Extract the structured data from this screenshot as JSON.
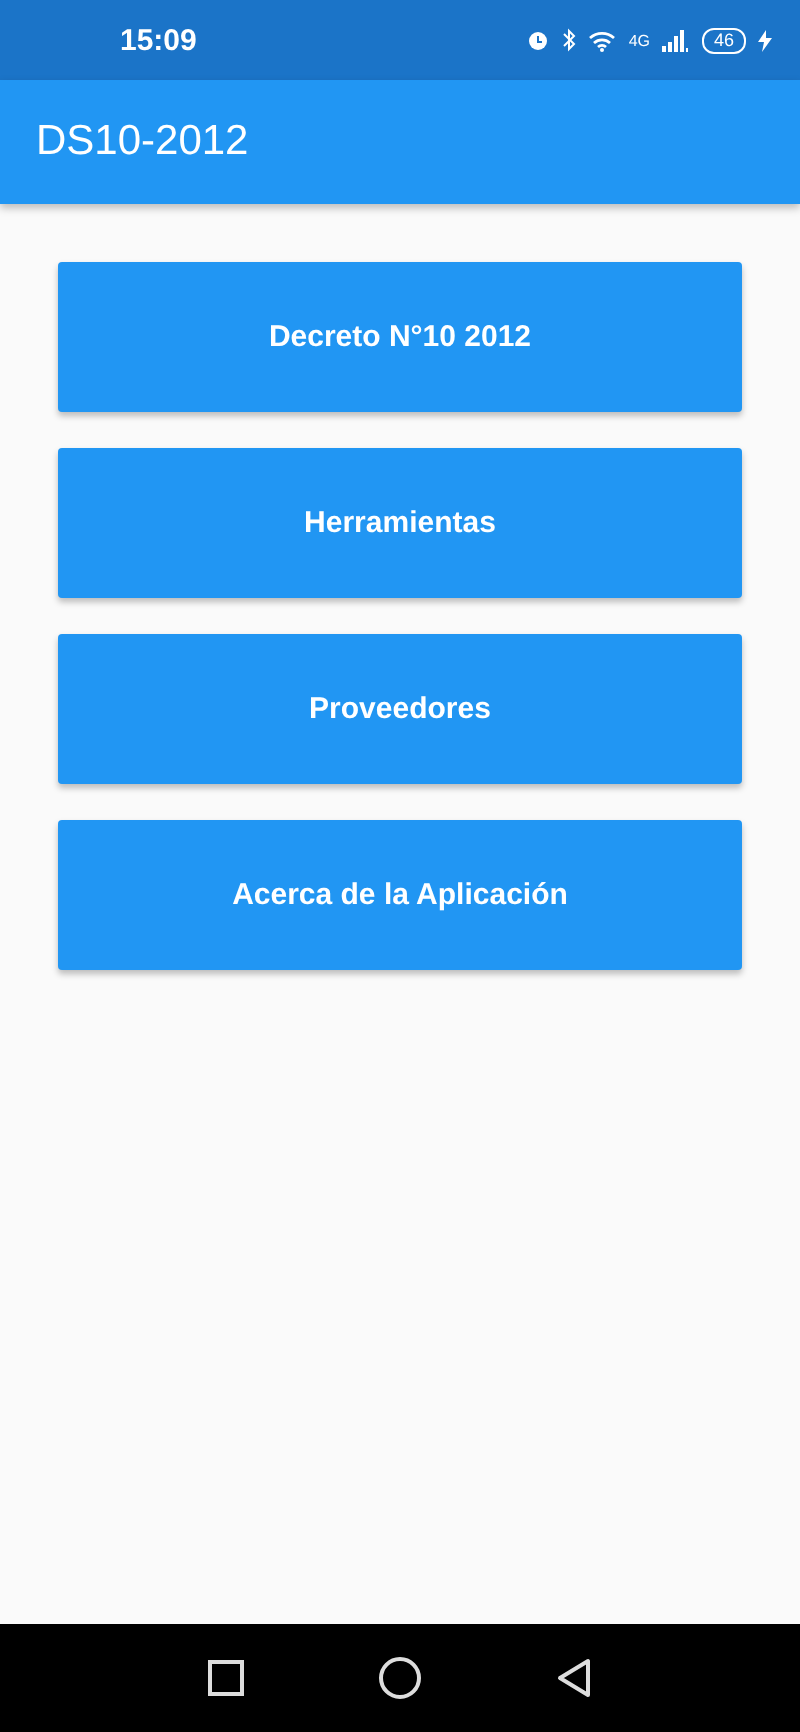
{
  "status_bar": {
    "time": "15:09",
    "network": "4G",
    "battery": "46"
  },
  "app_bar": {
    "title": "DS10-2012"
  },
  "menu_buttons": [
    {
      "label": "Decreto N°10 2012"
    },
    {
      "label": "Herramientas"
    },
    {
      "label": "Proveedores"
    },
    {
      "label": "Acerca de la Aplicación"
    }
  ]
}
